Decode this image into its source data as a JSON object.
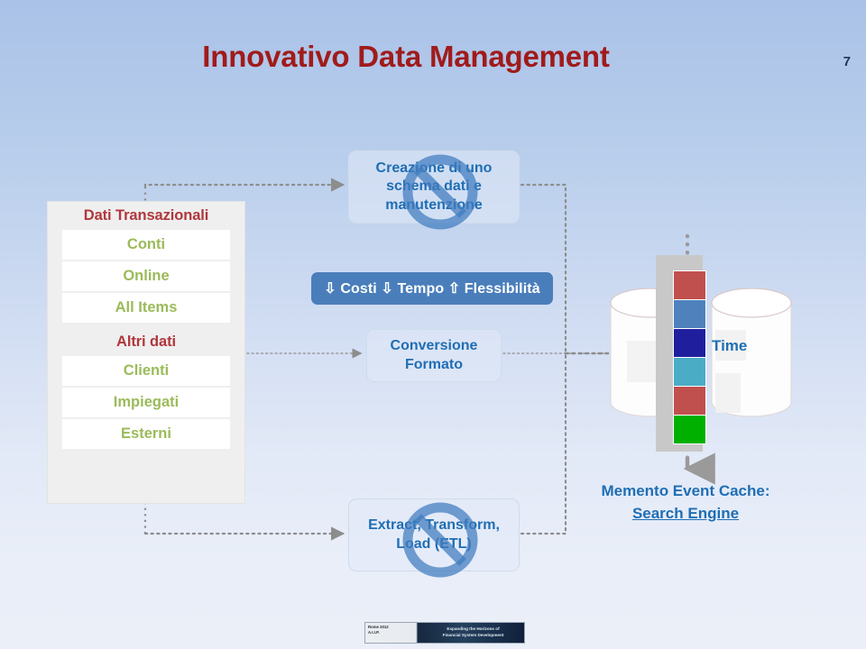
{
  "slide": {
    "title": "Innovativo Data Management",
    "page_number": "7",
    "title_color": "#a01b1b",
    "background_top_color": "#aac2e8",
    "background_bottom_color": "#eaeff8"
  },
  "left_panel": {
    "groups": [
      {
        "header": "Dati Transazionali",
        "items": [
          "Conti",
          "Online",
          "All Items"
        ]
      },
      {
        "header": "Altri dati",
        "items": [
          "Clienti",
          "Impiegati",
          "Esterni"
        ]
      }
    ],
    "header_color": "#b0373c",
    "item_color": "#9bbb59"
  },
  "center": {
    "box_schema": "Creazione di uno schema dati e manutenzione",
    "box_schema_disabled": true,
    "blue_bar": "⇩ Costi ⇩ Tempo ⇧ Flessibilità",
    "blue_bar_color": "#4a7ebb",
    "box_conversione": "Conversione Formato",
    "box_etl": "Extract, Transform, Load (ETL)",
    "box_etl_disabled": true,
    "box_text_color": "#1f6eb4"
  },
  "right": {
    "time_label": "Time",
    "caption_line1": "Memento Event Cache:",
    "caption_line2": "Search Engine",
    "blocks": [
      {
        "color": "#c0504d"
      },
      {
        "color": "#4f81bd"
      },
      {
        "color": "#1f1f9e"
      },
      {
        "color": "#4bacc6"
      },
      {
        "color": "#c0504d"
      },
      {
        "color": "#00b000"
      }
    ]
  },
  "footer": {
    "banner_left_line1": "Rome 2012",
    "banner_left_line2": "A.I.I.P.",
    "banner_right_line1": "Expanding the Horizons of",
    "banner_right_line2": "Financial System Development"
  }
}
